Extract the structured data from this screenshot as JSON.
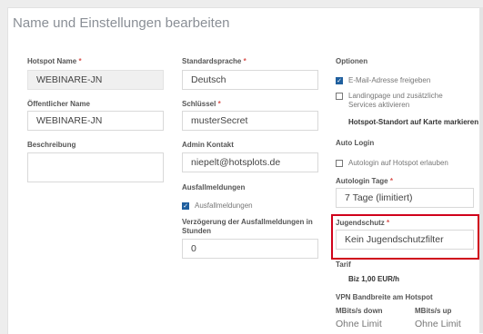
{
  "title": "Name und Einstellungen bearbeiten",
  "col1": {
    "hotspot_name_label": "Hotspot Name",
    "hotspot_name_value": "WEBINARE-JN",
    "public_name_label": "Öffentlicher Name",
    "public_name_value": "WEBINARE-JN",
    "description_label": "Beschreibung",
    "description_value": ""
  },
  "col2": {
    "language_label": "Standardsprache",
    "language_value": "Deutsch",
    "key_label": "Schlüssel",
    "key_value": "musterSecret",
    "admin_label": "Admin Kontakt",
    "admin_value": "niepelt@hotsplots.de",
    "outage_heading": "Ausfallmeldungen",
    "outage_checkbox_label": "Ausfallmeldungen",
    "outage_checked": true,
    "delay_label": "Verzögerung der Ausfallmeldungen in Stunden",
    "delay_value": "0"
  },
  "col3": {
    "options_heading": "Optionen",
    "email_label": "E-Mail-Adresse freigeben",
    "email_checked": true,
    "landing_label": "Landingpage und zusätzliche Services aktivieren",
    "landing_checked": false,
    "map_label": "Hotspot-Standort auf Karte markieren",
    "autologin_heading": "Auto Login",
    "autologin_label": "Autologin auf Hotspot erlauben",
    "autologin_checked": false,
    "autologin_days_label": "Autologin Tage",
    "autologin_days_value": "7 Tage (limitiert)",
    "youth_label": "Jugendschutz",
    "youth_value": "Kein Jugendschutzfilter",
    "tarif_label": "Tarif",
    "tarif_value": "Biz 1,00 EUR/h",
    "vpn_heading": "VPN Bandbreite am Hotspot",
    "down_label": "MBits/s down",
    "up_label": "MBits/s up",
    "down_value": "Ohne Limit",
    "up_value": "Ohne Limit"
  },
  "required_marker": "*",
  "check_mark": "✓",
  "colors": {
    "accent": "#1f5f9e",
    "highlight": "#d0021b",
    "required": "#d9534f"
  }
}
